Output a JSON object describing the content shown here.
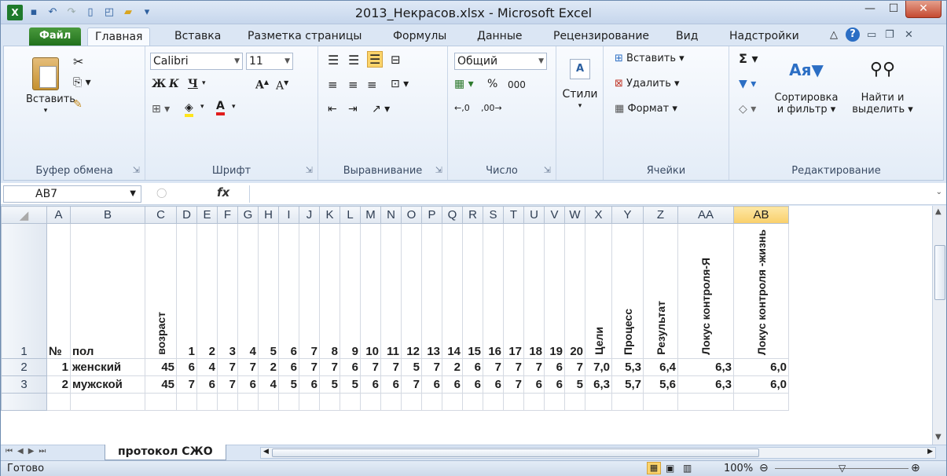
{
  "window": {
    "title": "2013_Некрасов.xlsx - Microsoft Excel"
  },
  "tabs": [
    "Файл",
    "Главная",
    "Вставка",
    "Разметка страницы",
    "Формулы",
    "Данные",
    "Рецензирование",
    "Вид",
    "Надстройки"
  ],
  "ribbon": {
    "clipboard": {
      "paste": "Вставить",
      "label": "Буфер обмена"
    },
    "font": {
      "name": "Calibri",
      "size": "11",
      "bold": "Ж",
      "italic": "К",
      "underline": "Ч",
      "label": "Шрифт"
    },
    "alignment": {
      "label": "Выравнивание"
    },
    "number": {
      "format": "Общий",
      "percent": "%",
      "thousands": "000",
      "label": "Число"
    },
    "styles": {
      "label": "Стили"
    },
    "cells": {
      "insert": "Вставить",
      "delete": "Удалить",
      "format": "Формат",
      "label": "Ячейки"
    },
    "editing": {
      "sort": "Сортировка",
      "sort2": "и фильтр",
      "find": "Найти и",
      "find2": "выделить",
      "label": "Редактирование"
    }
  },
  "formula_bar": {
    "name_box": "AB7",
    "fx": "fx",
    "value": ""
  },
  "columns": [
    "A",
    "B",
    "C",
    "D",
    "E",
    "F",
    "G",
    "H",
    "I",
    "J",
    "K",
    "L",
    "M",
    "N",
    "O",
    "P",
    "Q",
    "R",
    "S",
    "T",
    "U",
    "V",
    "W",
    "X",
    "Y",
    "Z",
    "AA",
    "AB"
  ],
  "selected_column": "AB",
  "rows": {
    "header": {
      "num": "1",
      "A": "№",
      "B": "пол",
      "C": "возраст",
      "items": [
        "1",
        "2",
        "3",
        "4",
        "5",
        "6",
        "7",
        "8",
        "9",
        "10",
        "11",
        "12",
        "13",
        "14",
        "15",
        "16",
        "17",
        "18",
        "19",
        "20"
      ],
      "X": "Цели",
      "Y": "Процесс",
      "Z": "Результат",
      "AA": "Локус контроля-Я",
      "AB": "Локус контроля -жизнь"
    },
    "data": [
      {
        "num": "2",
        "A": "1",
        "B": "женский",
        "C": "45",
        "items": [
          "6",
          "4",
          "7",
          "7",
          "2",
          "6",
          "7",
          "7",
          "6",
          "7",
          "7",
          "5",
          "7",
          "2",
          "6",
          "7",
          "7",
          "7",
          "6",
          "7"
        ],
        "X": "7,0",
        "Y": "5,3",
        "Z": "6,4",
        "AA": "6,3",
        "AB": "6,0"
      },
      {
        "num": "3",
        "A": "2",
        "B": "мужской",
        "C": "45",
        "items": [
          "7",
          "6",
          "7",
          "6",
          "4",
          "5",
          "6",
          "5",
          "5",
          "6",
          "6",
          "7",
          "6",
          "6",
          "6",
          "6",
          "7",
          "6",
          "6",
          "5"
        ],
        "X": "6,3",
        "Y": "5,7",
        "Z": "5,6",
        "AA": "6,3",
        "AB": "6,0"
      }
    ]
  },
  "sheet_tab": "протокол СЖО",
  "status": {
    "ready": "Готово",
    "zoom": "100%"
  }
}
